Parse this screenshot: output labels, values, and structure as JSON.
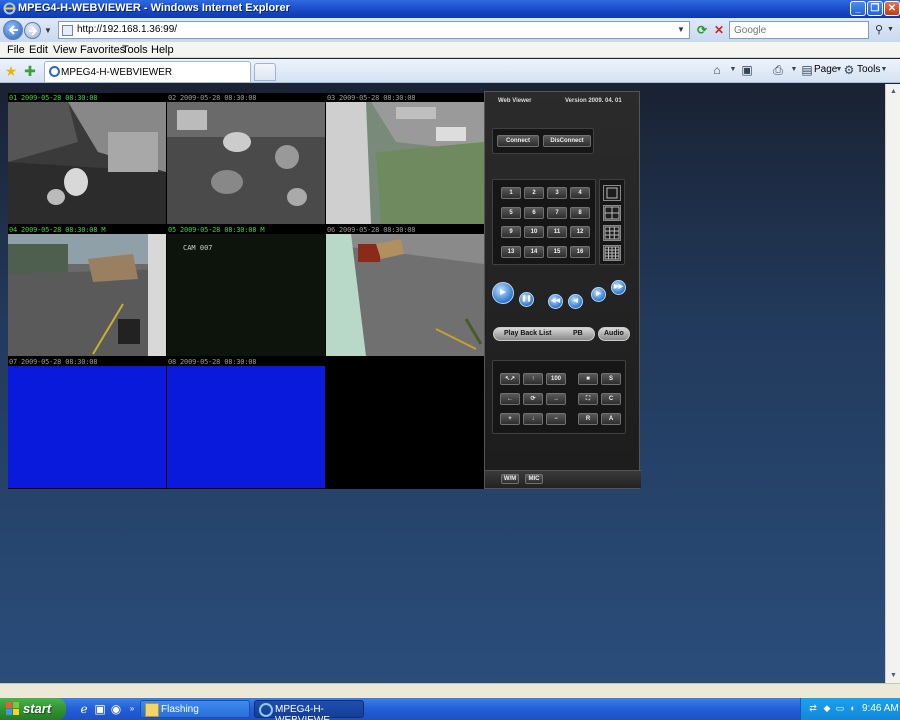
{
  "window": {
    "title": "MPEG4-H-WEBVIEWER - Windows Internet Explorer",
    "minimize": "_",
    "restore": "❐",
    "close": "✕"
  },
  "address_bar": {
    "url": "http://192.168.1.36:99/",
    "search_placeholder": "Google"
  },
  "menu": {
    "items": [
      "File",
      "Edit",
      "View",
      "Favorites",
      "Tools",
      "Help"
    ]
  },
  "tabs": {
    "active_label": "MPEG4-H-WEBVIEWER"
  },
  "command_bar": {
    "page": "Page",
    "tools": "Tools"
  },
  "cameras": [
    {
      "timestamp": "01 2009-05-28 08:30:08",
      "ts_color": "#3cd43c",
      "feed": "office-room"
    },
    {
      "timestamp": "02 2009-05-28 08:30:08",
      "ts_color": "#9a9a9a",
      "feed": "office-chairs"
    },
    {
      "timestamp": "03 2009-05-28 08:30:08",
      "ts_color": "#9a9a9a",
      "feed": "outdoor-side"
    },
    {
      "timestamp": "04 2009-05-28 08:30:08 M",
      "ts_color": "#3cd43c",
      "feed": "parking-lot"
    },
    {
      "timestamp": "05 2009-05-28 08:30:08 M",
      "ts_color": "#3cd43c",
      "feed": "dark",
      "overlay": "CAM 007"
    },
    {
      "timestamp": "06 2009-05-28 08:30:08",
      "ts_color": "#9a9a9a",
      "feed": "yard-corner"
    },
    {
      "timestamp": "07 2009-05-28 08:30:08",
      "ts_color": "#9a9a9a",
      "feed": "no-signal-blue"
    },
    {
      "timestamp": "08 2009-05-28 08:30:08",
      "ts_color": "#9a9a9a",
      "feed": "no-signal-blue"
    },
    {
      "timestamp": "",
      "ts_color": "#9a9a9a",
      "feed": "black"
    }
  ],
  "panel": {
    "title": "Web Viewer",
    "version": "Version 2009. 04. 01",
    "connect": "Connect",
    "disconnect": "DisConnect",
    "channels": [
      "1",
      "2",
      "3",
      "4",
      "5",
      "6",
      "7",
      "8",
      "9",
      "10",
      "11",
      "12",
      "13",
      "14",
      "15",
      "16"
    ],
    "playback_list": "Play Back List",
    "pb": "PB",
    "audio": "Audio",
    "ptz": [
      "↖↗",
      "↑",
      "100",
      "■",
      "S",
      "←",
      "⟳",
      "→",
      "⛶",
      "C",
      "+",
      "↓",
      "−",
      "R",
      "A"
    ],
    "bottom_left": "W/M",
    "bottom_right": "MIC"
  },
  "taskbar": {
    "start": "start",
    "tasks": [
      "Flashing",
      "MPEG4-H-WEBVIEWE..."
    ],
    "clock": "9:46 AM"
  },
  "colors": {
    "xp_blue": "#245ed6",
    "accent_green": "#3cd43c",
    "no_signal_blue": "#0a1adc"
  }
}
